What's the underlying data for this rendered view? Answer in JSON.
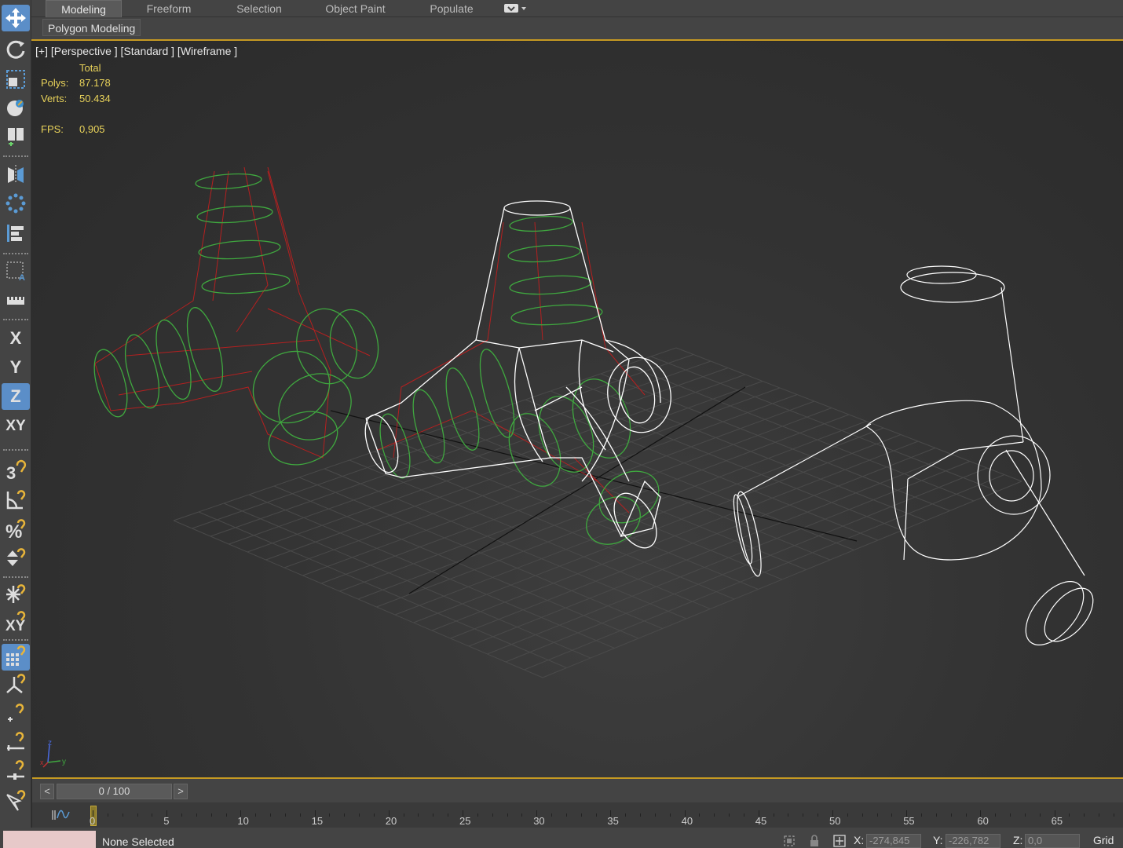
{
  "ribbon": {
    "tabs": [
      "Modeling",
      "Freeform",
      "Selection",
      "Object Paint",
      "Populate"
    ],
    "active_tab": "Modeling",
    "panel_button": "Polygon Modeling"
  },
  "toolbar": {
    "axis_x": "X",
    "axis_y": "Y",
    "axis_z": "Z",
    "axis_xy": "XY",
    "icons": [
      "move-icon",
      "rotate-icon",
      "scale-icon",
      "place-icon",
      "link-icon",
      "mirror-icon",
      "array-icon",
      "align-icon",
      "selection-set-icon",
      "ruler-icon",
      "snap-3d-icon",
      "angle-snap-icon",
      "percent-snap-icon",
      "spinner-snap-icon",
      "freeze-icon",
      "xy-snap-icon",
      "grid-snap-icon",
      "axis-constraint-icon",
      "snap-point-icon",
      "snap-edge-icon",
      "snap-slider-icon",
      "select-tool-icon"
    ],
    "active_axis": "Z"
  },
  "viewport": {
    "label": "[+] [Perspective ] [Standard ] [Wireframe ]",
    "stats": {
      "header": "Total",
      "polys_label": "Polys:",
      "polys_value": "87.178",
      "verts_label": "Verts:",
      "verts_value": "50.434",
      "fps_label": "FPS:",
      "fps_value": "0,905"
    },
    "tripod": {
      "x": "x",
      "y": "y",
      "z": "z"
    },
    "colors": {
      "wire_white": "#ffffff",
      "helix_green": "#3fa83f",
      "spline_red": "#b52020",
      "grid": "#4a4a4a"
    }
  },
  "time_slider": {
    "prev": "<",
    "next": ">",
    "frame_text": "0 / 100"
  },
  "track_bar": {
    "ticks": [
      "0",
      "5",
      "10",
      "15",
      "20",
      "25",
      "30",
      "35",
      "40",
      "45",
      "50",
      "55",
      "60",
      "65"
    ]
  },
  "status": {
    "selection": "None Selected",
    "x_label": "X:",
    "x_value": "-274,845",
    "y_label": "Y:",
    "y_value": "-226,782",
    "z_label": "Z:",
    "z_value": "0,0",
    "grid_label": "Grid ="
  }
}
